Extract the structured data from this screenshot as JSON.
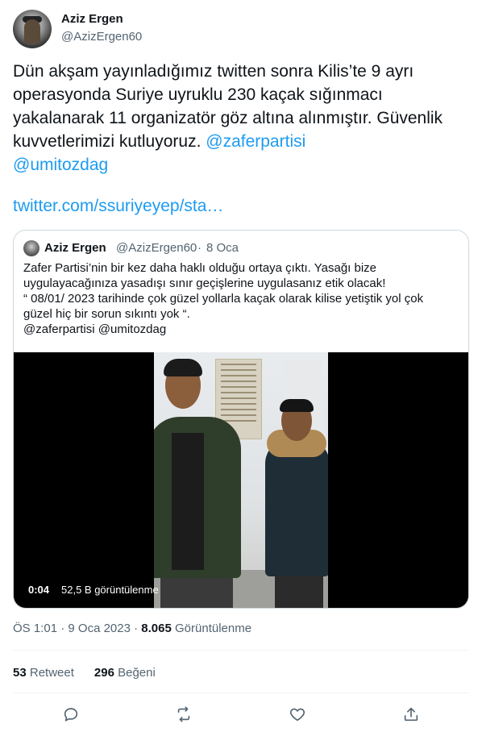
{
  "author": {
    "display_name": "Aziz Ergen",
    "handle": "@AzizErgen60"
  },
  "tweet": {
    "text": "Dün akşam yayınladığımız twitten sonra Kilis’te 9 ayrı operasyonda Suriye uyruklu 230 kaçak sığınmacı yakalanarak 11 organizatör göz altına alınmıştır. Güvenlik kuvvetlerimizi kutluyoruz.",
    "mention_1": "@zaferpartisi",
    "mention_2": "@umitozdag",
    "link": "twitter.com/ssuriyeyep/sta…"
  },
  "quote": {
    "display_name": "Aziz Ergen",
    "handle": "@AzizErgen60",
    "separator": "·",
    "date": "8 Oca",
    "lines": [
      "Zafer Partisi’nin bir kez daha haklı olduğu ortaya çıktı. Yasağı bize",
      "uygulayacağınıza yasadışı sınır geçişlerine uygulasanız etik olacak!",
      "“ 08/01/ 2023 tarihinde çok güzel yollarla kaçak olarak kilise yetiştik yol çok",
      "güzel hiç bir sorun sıkıntı yok “.",
      "@zaferpartisi @umitozdag"
    ],
    "video": {
      "duration": "0:04",
      "views": "52,5 B görüntülenme"
    }
  },
  "meta": {
    "time": "ÖS 1:01",
    "separator": "·",
    "date": "9 Oca 2023",
    "separator2": "·",
    "view_count": "8.065",
    "view_label": "Görüntülenme"
  },
  "stats": {
    "retweet_count": "53",
    "retweet_label": "Retweet",
    "like_count": "296",
    "like_label": "Beğeni"
  },
  "actions": {
    "icons": [
      "reply-icon",
      "retweet-icon",
      "like-icon",
      "share-icon"
    ]
  },
  "colors": {
    "link": "#1d9bf0",
    "text": "#0f1419",
    "secondary": "#536471",
    "border": "#cfd9de"
  }
}
